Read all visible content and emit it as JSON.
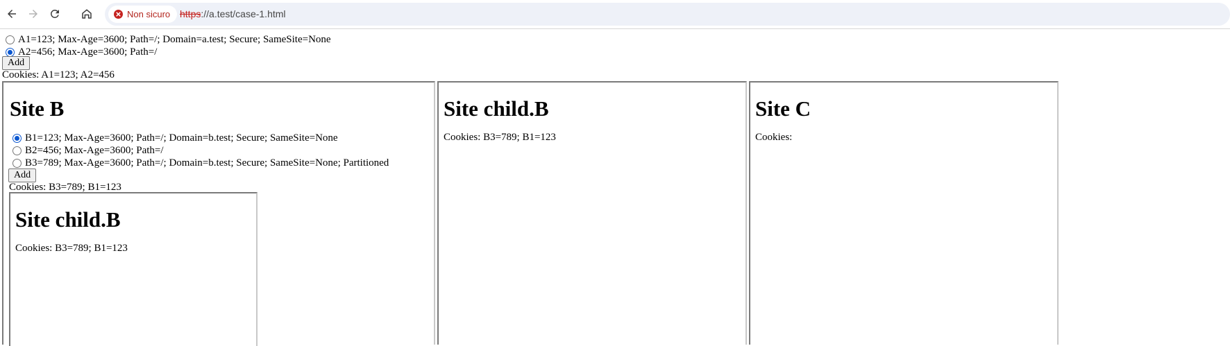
{
  "browser": {
    "security_label": "Non sicuro",
    "url_scheme": "https",
    "url_rest": "://a.test/case-1.html"
  },
  "main": {
    "radios": [
      {
        "label": "A1=123; Max-Age=3600; Path=/; Domain=a.test; Secure; SameSite=None",
        "checked": false
      },
      {
        "label": "A2=456; Max-Age=3600; Path=/",
        "checked": true
      }
    ],
    "add_label": "Add",
    "cookies_text": "Cookies: A1=123; A2=456"
  },
  "site_b": {
    "title": "Site B",
    "radios": [
      {
        "label": "B1=123; Max-Age=3600; Path=/; Domain=b.test; Secure; SameSite=None",
        "checked": true
      },
      {
        "label": "B2=456; Max-Age=3600; Path=/",
        "checked": false
      },
      {
        "label": "B3=789; Max-Age=3600; Path=/; Domain=b.test; Secure; SameSite=None; Partitioned",
        "checked": false
      }
    ],
    "add_label": "Add",
    "cookies_text": "Cookies: B3=789; B1=123",
    "nested": {
      "title": "Site child.B",
      "cookies_text": "Cookies: B3=789; B1=123"
    }
  },
  "site_child_b": {
    "title": "Site child.B",
    "cookies_text": "Cookies: B3=789; B1=123"
  },
  "site_c": {
    "title": "Site C",
    "cookies_text": "Cookies:"
  },
  "colors": {
    "radio_checked": "#0b57d0",
    "insecure_red": "#c5221f"
  }
}
